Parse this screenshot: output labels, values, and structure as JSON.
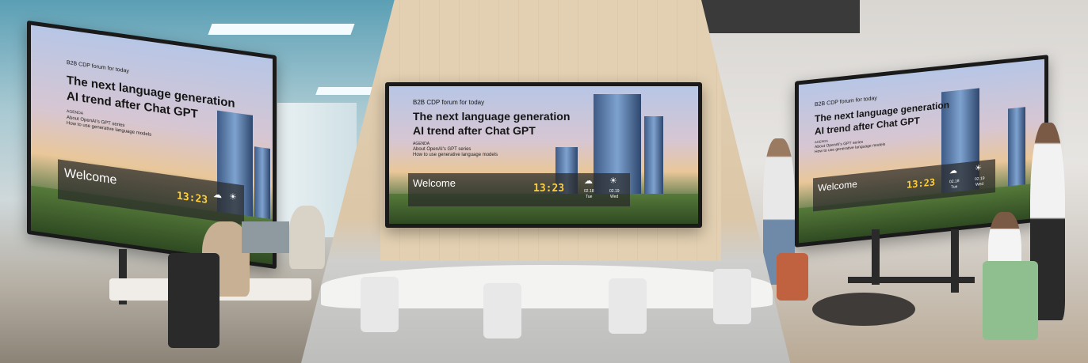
{
  "screen": {
    "kicker": "B2B CDP forum for today",
    "title_line1": "The next language generation",
    "title_line2": "AI trend after Chat GPT",
    "agenda_label": "AGENDA",
    "agenda_item1": "About OpenAI's GPT series",
    "agenda_item2": "How to use generative language models",
    "welcome": "Welcome",
    "clock_time": "13:23",
    "weather_day1_date": "02.18",
    "weather_day1_name": "Tue",
    "weather_day2_date": "02.19",
    "weather_day2_name": "Wed"
  }
}
